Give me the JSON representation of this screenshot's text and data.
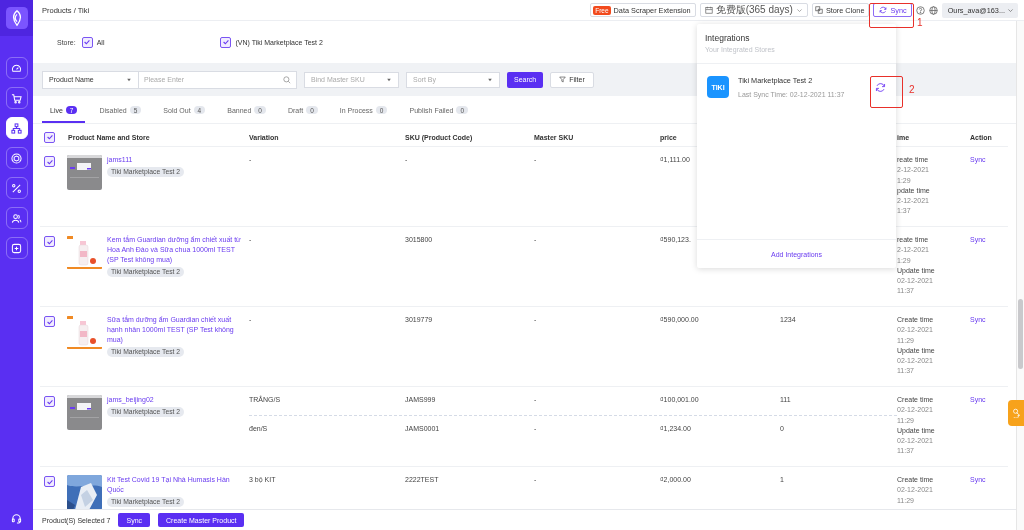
{
  "sidebar": {
    "items": [
      {
        "kind": "gauge",
        "selected": false
      },
      {
        "kind": "cart",
        "selected": false
      },
      {
        "kind": "network",
        "selected": true
      },
      {
        "kind": "box",
        "selected": false
      },
      {
        "kind": "percent",
        "selected": false
      },
      {
        "kind": "users",
        "selected": false
      },
      {
        "kind": "plus",
        "selected": false
      }
    ]
  },
  "breadcrumb": "Products / Tiki",
  "topbar": {
    "extension_badge": "Free",
    "extension": "Data Scraper Extension",
    "plan": "免费版(365 days)",
    "store_clone": "Store Clone",
    "sync": "Sync",
    "account": "Ours_ava@163..."
  },
  "store_filter": {
    "label": "Store:",
    "options": [
      {
        "label": "All",
        "checked": true
      },
      {
        "label": "(VN) Tiki Marketplace Test 2",
        "checked": true
      }
    ]
  },
  "filters": {
    "field": "Product Name",
    "search_placeholder": "Please Enter",
    "bind_placeholder": "Bind Master SKU",
    "sort_placeholder": "Sort By",
    "search_button": "Search",
    "filter_button": "Filter"
  },
  "tabs": [
    {
      "label": "Live",
      "count": "7",
      "selected": true
    },
    {
      "label": "Disabled",
      "count": "5",
      "selected": false
    },
    {
      "label": "Sold Out",
      "count": "4",
      "selected": false
    },
    {
      "label": "Banned",
      "count": "0",
      "selected": false
    },
    {
      "label": "Draft",
      "count": "0",
      "selected": false
    },
    {
      "label": "In Process",
      "count": "0",
      "selected": false
    },
    {
      "label": "Publish Failed",
      "count": "0",
      "selected": false
    }
  ],
  "table": {
    "all_checked": true,
    "columns": [
      "Product Name and Store",
      "Variation",
      "SKU (Product Code)",
      "Master SKU",
      "price",
      "ime",
      "Action"
    ],
    "rows": [
      {
        "selected": true,
        "name": "jams111",
        "store": "Tiki Marketplace Test 2",
        "variants": [
          {
            "variation": "-",
            "sku": "-",
            "master_sku": "-",
            "price": "₫1,111.00"
          }
        ],
        "time": [
          {
            "kind": "label",
            "text": "reate time"
          },
          {
            "kind": "value",
            "text": "2-12-2021"
          },
          {
            "kind": "value",
            "text": "1:29"
          },
          {
            "kind": "label",
            "text": "pdate time"
          },
          {
            "kind": "value",
            "text": "2-12-2021"
          },
          {
            "kind": "value",
            "text": "1:37"
          }
        ],
        "action": "Sync"
      },
      {
        "selected": true,
        "name": "Kem tắm Guardian dưỡng ẩm chiết xuất từ Hoa Anh Đào và Sữa chua 1000ml TEST (SP Test không mua)",
        "store": "Tiki Marketplace Test 2",
        "variants": [
          {
            "variation": "-",
            "sku": "3015800",
            "master_sku": "-",
            "price": "₫590,123."
          }
        ],
        "time": [
          {
            "kind": "label",
            "text": "reate time"
          },
          {
            "kind": "value",
            "text": "2-12-2021"
          },
          {
            "kind": "value",
            "text": "1:29"
          },
          {
            "kind": "label",
            "text": "Update time"
          },
          {
            "kind": "value",
            "text": "02-12-2021"
          },
          {
            "kind": "value",
            "text": "11:37"
          }
        ],
        "action": "Sync"
      },
      {
        "selected": true,
        "name": "Sữa tắm dưỡng ẩm Guardian chiết xuất hạnh nhân 1000ml TEST (SP Test không mua)",
        "store": "Tiki Marketplace Test 2",
        "variants": [
          {
            "variation": "-",
            "sku": "3019779",
            "master_sku": "-",
            "price": "₫590,000.00",
            "column_6": "1234"
          }
        ],
        "time": [
          {
            "kind": "label",
            "text": "Create time"
          },
          {
            "kind": "value",
            "text": "02-12-2021"
          },
          {
            "kind": "value",
            "text": "11:29"
          },
          {
            "kind": "label",
            "text": "Update time"
          },
          {
            "kind": "value",
            "text": "02-12-2021"
          },
          {
            "kind": "value",
            "text": "11:37"
          }
        ],
        "action": "Sync"
      },
      {
        "selected": true,
        "name": "jams_beijing02",
        "store": "Tiki Marketplace Test 2",
        "variants": [
          {
            "variation": "TRẮNG/S",
            "sku": "JAMS999",
            "master_sku": "-",
            "price": "₫100,001.00",
            "column_6": "111"
          },
          {
            "variation": "đen/S",
            "sku": "JAMS0001",
            "master_sku": "-",
            "price": "₫1,234.00",
            "column_6": "0"
          }
        ],
        "time": [
          {
            "kind": "label",
            "text": "Create time"
          },
          {
            "kind": "value",
            "text": "02-12-2021"
          },
          {
            "kind": "value",
            "text": "11:29"
          },
          {
            "kind": "label",
            "text": "Update time"
          },
          {
            "kind": "value",
            "text": "02-12-2021"
          },
          {
            "kind": "value",
            "text": "11:37"
          }
        ],
        "action": "Sync"
      },
      {
        "selected": true,
        "name": "Kit Test Covid 19 Tại Nhà Humasis Hàn Quốc",
        "store": "Tiki Marketplace Test 2",
        "variants": [
          {
            "variation": "3 bộ KIT",
            "sku": "2222TEST",
            "master_sku": "-",
            "price": "₫2,000.00",
            "column_6": "1"
          }
        ],
        "time": [
          {
            "kind": "label",
            "text": "Create time"
          },
          {
            "kind": "value",
            "text": "02-12-2021"
          },
          {
            "kind": "value",
            "text": "11:29"
          }
        ],
        "action": "Sync"
      }
    ]
  },
  "bottom_bar": {
    "selected_count": "Product(S) Selected 7",
    "sync_button": "Sync",
    "create_button": "Create Master Product"
  },
  "integrations_popover": {
    "title": "Integrations",
    "subtitle": "Your Integrated Stores",
    "stores": [
      {
        "logo_text": "TIKI",
        "name": "Tiki Marketplace Test 2",
        "last_sync": "Last Sync Time: 02-12-2021 11:37"
      }
    ],
    "add_link": "Add Integrations"
  },
  "annotations": [
    "1",
    "2"
  ]
}
